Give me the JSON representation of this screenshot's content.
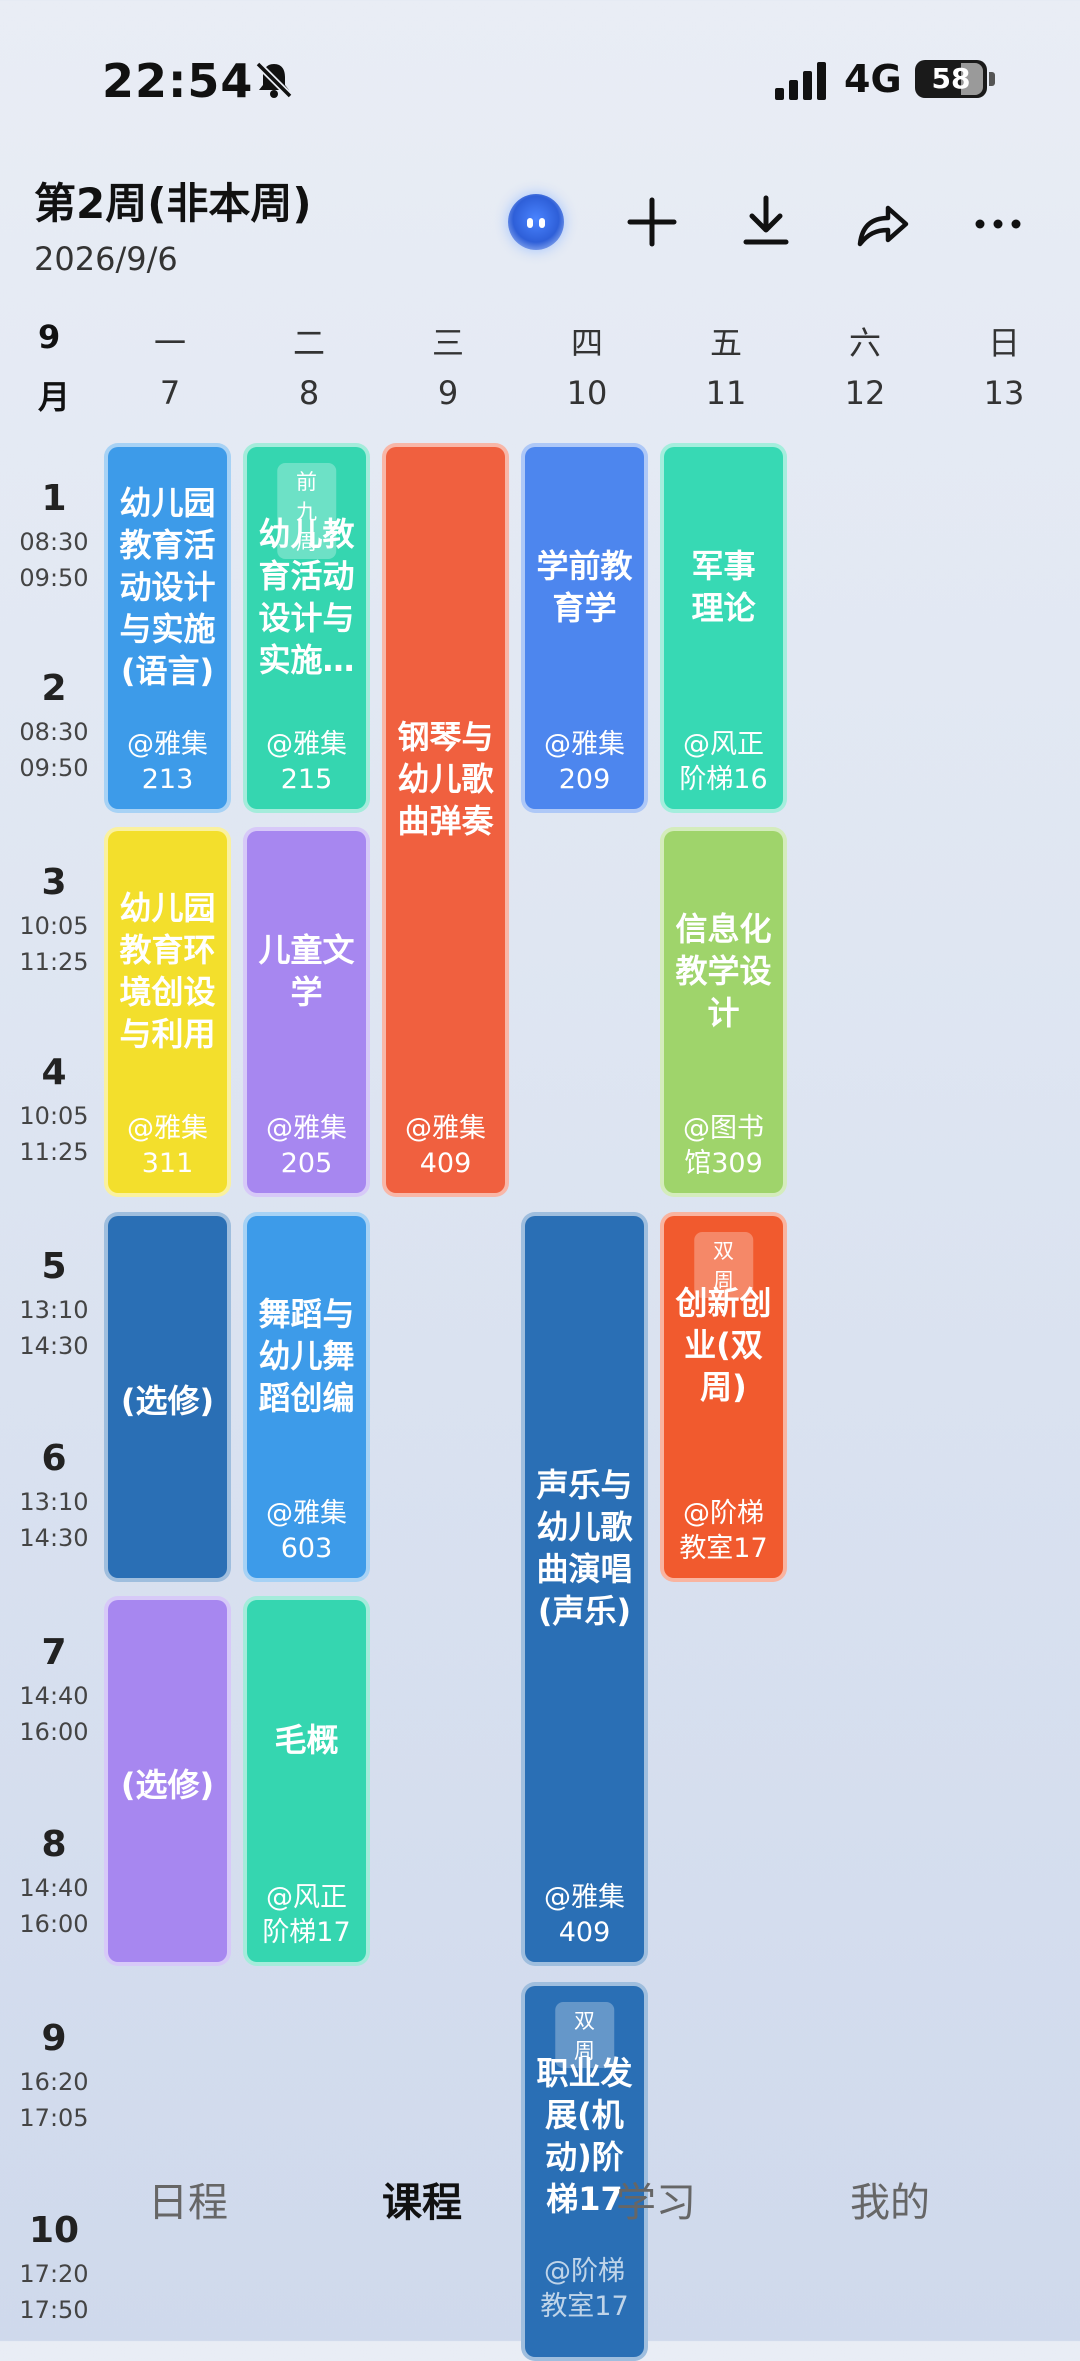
{
  "status_bar": {
    "time": "22:54",
    "network": "4G",
    "battery": "58"
  },
  "header": {
    "week_title": "第2周(非本周)",
    "date": "2026/9/6",
    "icons": [
      "ai-assistant-icon",
      "plus-icon",
      "download-icon",
      "share-icon",
      "more-icon"
    ]
  },
  "calendar": {
    "month_num": "9",
    "month_label": "月",
    "days": [
      {
        "name": "一",
        "date": "7"
      },
      {
        "name": "二",
        "date": "8"
      },
      {
        "name": "三",
        "date": "9"
      },
      {
        "name": "四",
        "date": "10"
      },
      {
        "name": "五",
        "date": "11"
      },
      {
        "name": "六",
        "date": "12"
      },
      {
        "name": "日",
        "date": "13"
      }
    ],
    "periods": [
      {
        "num": "1",
        "start": "08:30",
        "end": "09:50"
      },
      {
        "num": "2",
        "start": "08:30",
        "end": "09:50"
      },
      {
        "num": "3",
        "start": "10:05",
        "end": "11:25"
      },
      {
        "num": "4",
        "start": "10:05",
        "end": "11:25"
      },
      {
        "num": "5",
        "start": "13:10",
        "end": "14:30"
      },
      {
        "num": "6",
        "start": "13:10",
        "end": "14:30"
      },
      {
        "num": "7",
        "start": "14:40",
        "end": "16:00"
      },
      {
        "num": "8",
        "start": "14:40",
        "end": "16:00"
      },
      {
        "num": "9",
        "start": "16:20",
        "end": "17:05"
      },
      {
        "num": "10",
        "start": "17:20",
        "end": "17:50"
      }
    ]
  },
  "courses": [
    {
      "name_lines": [
        "幼儿园",
        "教育活",
        "动设计",
        "与实施",
        "(语言)"
      ],
      "loc_lines": [
        "@雅集",
        "213"
      ],
      "tag": "",
      "color": "#3d9be9"
    },
    {
      "name_lines": [
        "幼儿教",
        "育活动",
        "设计与",
        "实施…"
      ],
      "loc_lines": [
        "@雅集",
        "215"
      ],
      "tag": "前九周",
      "color": "#35d6b0"
    },
    {
      "name_lines": [
        "钢琴与",
        "幼儿歌",
        "曲弹奏"
      ],
      "loc_lines": [
        "@雅集",
        "409"
      ],
      "tag": "",
      "color": "#f0603f"
    },
    {
      "name_lines": [
        "学前教",
        "育学"
      ],
      "loc_lines": [
        "@雅集",
        "209"
      ],
      "tag": "",
      "color": "#4d86ee"
    },
    {
      "name_lines": [
        "军事",
        "理论"
      ],
      "loc_lines": [
        "@风正",
        "阶梯16"
      ],
      "tag": "",
      "color": "#37d9b4"
    },
    {
      "name_lines": [
        "幼儿园",
        "教育环",
        "境创设",
        "与利用"
      ],
      "loc_lines": [
        "@雅集",
        "311"
      ],
      "tag": "",
      "color": "#f3df2c"
    },
    {
      "name_lines": [
        "儿童文",
        "学"
      ],
      "loc_lines": [
        "@雅集",
        "205"
      ],
      "tag": "",
      "color": "#a787f0"
    },
    {
      "name_lines": [
        "信息化",
        "教学设",
        "计"
      ],
      "loc_lines": [
        "@图书",
        "馆309"
      ],
      "tag": "",
      "color": "#9fd46b"
    },
    {
      "name_lines": [
        "(选修)"
      ],
      "loc_lines": [],
      "tag": "",
      "color": "#2a6fb5"
    },
    {
      "name_lines": [
        "舞蹈与",
        "幼儿舞",
        "蹈创编"
      ],
      "loc_lines": [
        "@雅集",
        "603"
      ],
      "tag": "",
      "color": "#3d9be9"
    },
    {
      "name_lines": [
        "声乐与",
        "幼儿歌",
        "曲演唱",
        "(声乐)"
      ],
      "loc_lines": [
        "@雅集",
        "409"
      ],
      "tag": "",
      "color": "#2a6fb5"
    },
    {
      "name_lines": [
        "创新创",
        "业(双",
        "周)"
      ],
      "loc_lines": [
        "@阶梯",
        "教室17"
      ],
      "tag": "双周",
      "color": "#f15a2e"
    },
    {
      "name_lines": [
        "(选修)"
      ],
      "loc_lines": [],
      "tag": "",
      "color": "#a787f0"
    },
    {
      "name_lines": [
        "毛概"
      ],
      "loc_lines": [
        "@风正",
        "阶梯17"
      ],
      "tag": "",
      "color": "#35d6b0"
    },
    {
      "name_lines": [
        "职业发",
        "展(机",
        "动)阶",
        "梯17"
      ],
      "loc_lines": [
        "@阶梯",
        "教室17"
      ],
      "tag": "双周",
      "color": "#2a6fb5"
    }
  ],
  "bottom_nav": [
    {
      "label": "日程",
      "active": false
    },
    {
      "label": "课程",
      "active": true
    },
    {
      "label": "学习",
      "active": false
    },
    {
      "label": "我的",
      "active": false
    }
  ]
}
